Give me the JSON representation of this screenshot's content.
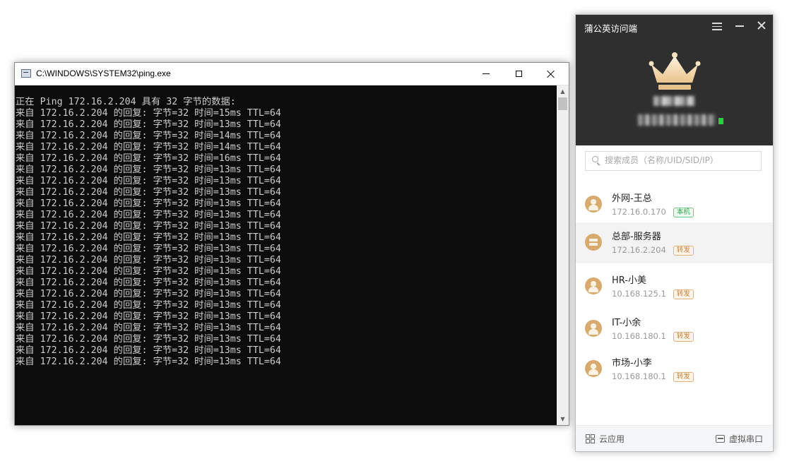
{
  "console": {
    "title": "C:\\WINDOWS\\SYSTEM32\\ping.exe",
    "lines": [
      "正在 Ping 172.16.2.204 具有 32 字节的数据:",
      "来自 172.16.2.204 的回复: 字节=32 时间=15ms TTL=64",
      "来自 172.16.2.204 的回复: 字节=32 时间=13ms TTL=64",
      "来自 172.16.2.204 的回复: 字节=32 时间=14ms TTL=64",
      "来自 172.16.2.204 的回复: 字节=32 时间=14ms TTL=64",
      "来自 172.16.2.204 的回复: 字节=32 时间=16ms TTL=64",
      "来自 172.16.2.204 的回复: 字节=32 时间=13ms TTL=64",
      "来自 172.16.2.204 的回复: 字节=32 时间=13ms TTL=64",
      "来自 172.16.2.204 的回复: 字节=32 时间=13ms TTL=64",
      "来自 172.16.2.204 的回复: 字节=32 时间=13ms TTL=64",
      "来自 172.16.2.204 的回复: 字节=32 时间=13ms TTL=64",
      "来自 172.16.2.204 的回复: 字节=32 时间=13ms TTL=64",
      "来自 172.16.2.204 的回复: 字节=32 时间=13ms TTL=64",
      "来自 172.16.2.204 的回复: 字节=32 时间=13ms TTL=64",
      "来自 172.16.2.204 的回复: 字节=32 时间=13ms TTL=64",
      "来自 172.16.2.204 的回复: 字节=32 时间=13ms TTL=64",
      "来自 172.16.2.204 的回复: 字节=32 时间=13ms TTL=64",
      "来自 172.16.2.204 的回复: 字节=32 时间=13ms TTL=64",
      "来自 172.16.2.204 的回复: 字节=32 时间=13ms TTL=64",
      "来自 172.16.2.204 的回复: 字节=32 时间=13ms TTL=64",
      "来自 172.16.2.204 的回复: 字节=32 时间=13ms TTL=64",
      "来自 172.16.2.204 的回复: 字节=32 时间=13ms TTL=64",
      "来自 172.16.2.204 的回复: 字节=32 时间=13ms TTL=64",
      "来自 172.16.2.204 的回复: 字节=32 时间=13ms TTL=64"
    ],
    "scrollbar": {
      "up_glyph": "▲",
      "down_glyph": "▼"
    }
  },
  "client": {
    "title": "蒲公英访问端",
    "search": {
      "placeholder": "搜索成员（名称/UID/SID/IP）"
    },
    "accent_color": "#d8aa6e",
    "members": [
      {
        "name": "外网-王总",
        "ip": "172.16.0.170",
        "badge": "本机",
        "badge_type": "green",
        "icon": "person-icon",
        "selected": false
      },
      {
        "name": "总部-服务器",
        "ip": "172.16.2.204",
        "badge": "转发",
        "badge_type": "orange",
        "icon": "server-icon",
        "selected": true
      },
      {
        "name": "HR-小美",
        "ip": "10.168.125.1",
        "badge": "转发",
        "badge_type": "orange",
        "icon": "person-icon",
        "selected": false
      },
      {
        "name": "IT-小余",
        "ip": "10.168.180.1",
        "badge": "转发",
        "badge_type": "orange",
        "icon": "person-icon",
        "selected": false
      },
      {
        "name": "市场-小李",
        "ip": "10.168.180.1",
        "badge": "转发",
        "badge_type": "orange",
        "icon": "person-icon",
        "selected": false
      }
    ],
    "footer": {
      "cloud_apps_label": "云应用",
      "virtual_serial_label": "虚拟串口"
    }
  }
}
